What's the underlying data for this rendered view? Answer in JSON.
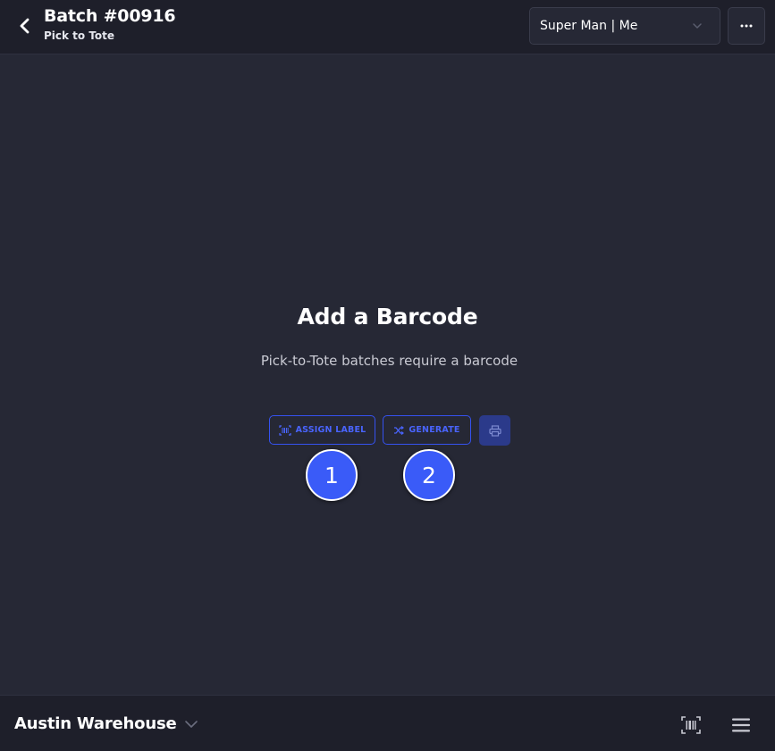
{
  "header": {
    "title": "Batch #00916",
    "subtitle": "Pick to Tote",
    "user_select": {
      "value": "Super Man | Me"
    },
    "more_label": "···"
  },
  "main": {
    "heading": "Add a Barcode",
    "description": "Pick-to-Tote batches require a barcode",
    "buttons": {
      "assign_label": "ASSIGN LABEL",
      "generate": "GENERATE"
    },
    "badges": [
      "1",
      "2"
    ]
  },
  "footer": {
    "warehouse": "Austin Warehouse"
  },
  "colors": {
    "background": "#262835",
    "header": "#1e1f2a",
    "accent": "#3a5bf8",
    "accent_text": "#4964ff"
  },
  "icons": [
    "chevron-left-icon",
    "chevron-down-icon",
    "more-icon",
    "barcode-icon",
    "shuffle-icon",
    "printer-icon",
    "menu-icon"
  ]
}
